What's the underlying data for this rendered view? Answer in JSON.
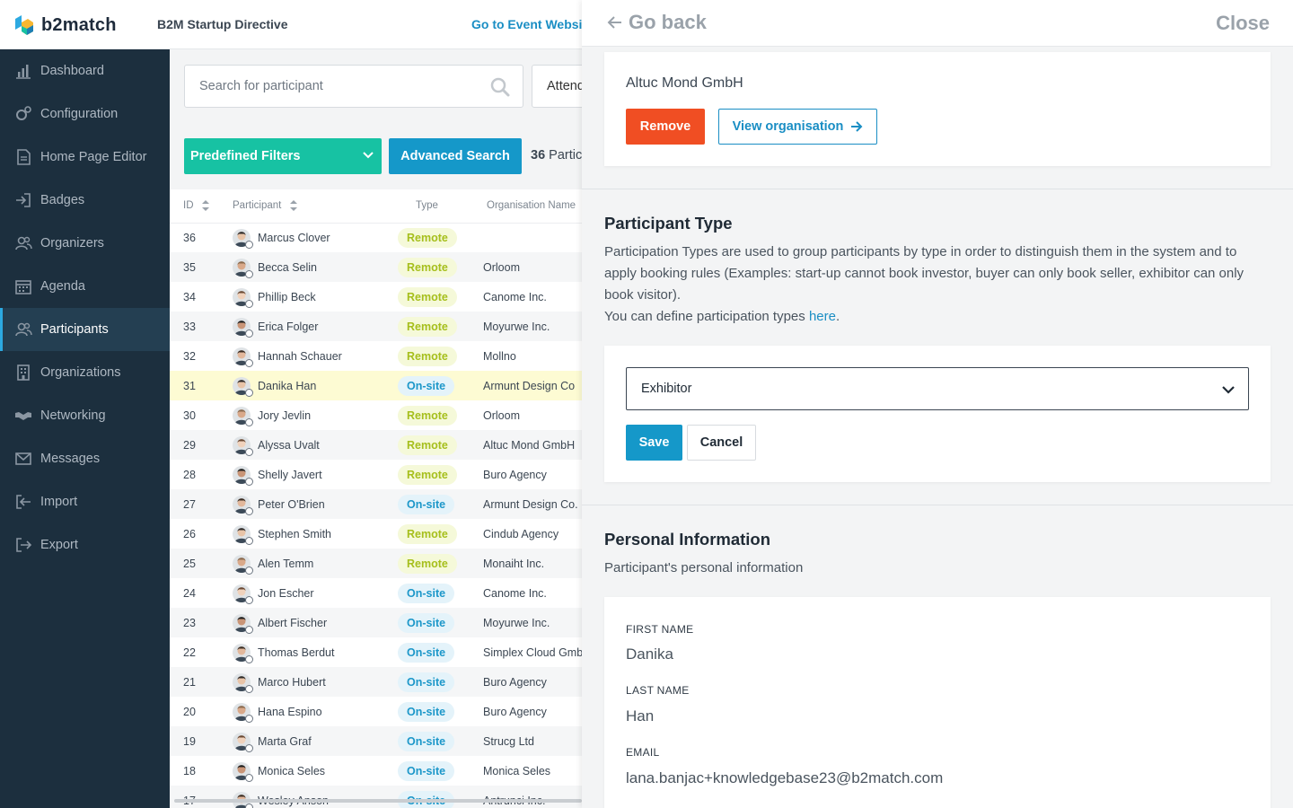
{
  "header": {
    "logo_text": "b2match",
    "event_title": "B2M Startup Directive",
    "event_link": "Go to Event Website"
  },
  "sidebar": {
    "items": [
      {
        "label": "Dashboard",
        "icon": "bar-chart-icon",
        "active": false
      },
      {
        "label": "Configuration",
        "icon": "gears-icon",
        "active": false
      },
      {
        "label": "Home Page Editor",
        "icon": "page-icon",
        "active": false
      },
      {
        "label": "Badges",
        "icon": "sign-in-icon",
        "active": false
      },
      {
        "label": "Organizers",
        "icon": "users-icon",
        "active": false
      },
      {
        "label": "Agenda",
        "icon": "calendar-icon",
        "active": false
      },
      {
        "label": "Participants",
        "icon": "users-icon",
        "active": true
      },
      {
        "label": "Organizations",
        "icon": "building-icon",
        "active": false
      },
      {
        "label": "Networking",
        "icon": "handshake-icon",
        "active": false
      },
      {
        "label": "Messages",
        "icon": "envelope-icon",
        "active": false
      },
      {
        "label": "Import",
        "icon": "import-icon",
        "active": false
      },
      {
        "label": "Export",
        "icon": "export-icon",
        "active": false
      }
    ]
  },
  "filters": {
    "search_placeholder": "Search for participant",
    "attendance_label": "Attendance",
    "predefined_label": "Predefined Filters",
    "advanced_label": "Advanced Search",
    "count_number": "36",
    "count_suffix": "Participants"
  },
  "table": {
    "headers": {
      "id": "ID",
      "participant": "Participant",
      "type": "Type",
      "org": "Organisation Name"
    },
    "rows": [
      {
        "id": "36",
        "name": "Marcus Clover",
        "type": "Remote",
        "org": ""
      },
      {
        "id": "35",
        "name": "Becca Selin",
        "type": "Remote",
        "org": "Orloom"
      },
      {
        "id": "34",
        "name": "Phillip Beck",
        "type": "Remote",
        "org": "Canome Inc."
      },
      {
        "id": "33",
        "name": "Erica Folger",
        "type": "Remote",
        "org": "Moyurwe Inc."
      },
      {
        "id": "32",
        "name": "Hannah Schauer",
        "type": "Remote",
        "org": "Mollno"
      },
      {
        "id": "31",
        "name": "Danika Han",
        "type": "On-site",
        "org": "Armunt Design Co"
      },
      {
        "id": "30",
        "name": "Jory Jevlin",
        "type": "Remote",
        "org": "Orloom"
      },
      {
        "id": "29",
        "name": "Alyssa Uvalt",
        "type": "Remote",
        "org": "Altuc Mond GmbH"
      },
      {
        "id": "28",
        "name": "Shelly Javert",
        "type": "Remote",
        "org": "Buro Agency"
      },
      {
        "id": "27",
        "name": "Peter O'Brien",
        "type": "On-site",
        "org": "Armunt Design Co."
      },
      {
        "id": "26",
        "name": "Stephen Smith",
        "type": "Remote",
        "org": "Cindub Agency"
      },
      {
        "id": "25",
        "name": "Alen Temm",
        "type": "Remote",
        "org": "Monaiht Inc."
      },
      {
        "id": "24",
        "name": "Jon Escher",
        "type": "On-site",
        "org": "Canome Inc."
      },
      {
        "id": "23",
        "name": "Albert Fischer",
        "type": "On-site",
        "org": "Moyurwe Inc."
      },
      {
        "id": "22",
        "name": "Thomas Berdut",
        "type": "On-site",
        "org": "Simplex Cloud GmbH"
      },
      {
        "id": "21",
        "name": "Marco Hubert",
        "type": "On-site",
        "org": "Buro Agency"
      },
      {
        "id": "20",
        "name": "Hana Espino",
        "type": "On-site",
        "org": "Buro Agency"
      },
      {
        "id": "19",
        "name": "Marta Graf",
        "type": "On-site",
        "org": "Strucg Ltd"
      },
      {
        "id": "18",
        "name": "Monica Seles",
        "type": "On-site",
        "org": "Monica Seles"
      },
      {
        "id": "17",
        "name": "Wesley Anson",
        "type": "On-site",
        "org": "Antrunci Inc."
      }
    ]
  },
  "drawer": {
    "go_back": "Go back",
    "close": "Close",
    "org_name": "Altuc Mond GmbH",
    "remove_label": "Remove",
    "view_org_label": "View organisation",
    "participant_type": {
      "title": "Participant Type",
      "description": "Participation Types are used to group participants by type in order to distinguish them in the system and to apply booking rules (Examples: start-up cannot book investor, buyer can only book seller, exhibitor can only book visitor).",
      "define_prefix": "You can define participation types ",
      "define_link": "here",
      "define_suffix": ".",
      "selected": "Exhibitor",
      "save_label": "Save",
      "cancel_label": "Cancel"
    },
    "personal": {
      "title": "Personal Information",
      "description": "Participant's personal information",
      "first_name_label": "FIRST NAME",
      "first_name": "Danika",
      "last_name_label": "LAST NAME",
      "last_name": "Han",
      "email_label": "EMAIL",
      "email": "lana.banjac+knowledgebase23@b2match.com"
    }
  },
  "colors": {
    "sidebar_bg": "#1c2f3e",
    "accent_blue": "#1598c9",
    "teal": "#17c2a3",
    "remove_red": "#f04e23",
    "remote_badge": "#a6bf1c",
    "onsite_badge": "#1c97c9",
    "highlight_row": "#fdfbd3"
  }
}
